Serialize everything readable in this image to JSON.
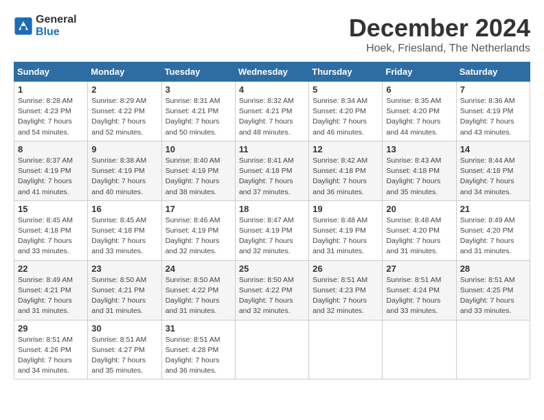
{
  "logo": {
    "line1": "General",
    "line2": "Blue"
  },
  "title": "December 2024",
  "subtitle": "Hoek, Friesland, The Netherlands",
  "days_header": [
    "Sunday",
    "Monday",
    "Tuesday",
    "Wednesday",
    "Thursday",
    "Friday",
    "Saturday"
  ],
  "weeks": [
    [
      {
        "day": "1",
        "sunrise": "8:28 AM",
        "sunset": "4:23 PM",
        "daylight": "7 hours and 54 minutes."
      },
      {
        "day": "2",
        "sunrise": "8:29 AM",
        "sunset": "4:22 PM",
        "daylight": "7 hours and 52 minutes."
      },
      {
        "day": "3",
        "sunrise": "8:31 AM",
        "sunset": "4:21 PM",
        "daylight": "7 hours and 50 minutes."
      },
      {
        "day": "4",
        "sunrise": "8:32 AM",
        "sunset": "4:21 PM",
        "daylight": "7 hours and 48 minutes."
      },
      {
        "day": "5",
        "sunrise": "8:34 AM",
        "sunset": "4:20 PM",
        "daylight": "7 hours and 46 minutes."
      },
      {
        "day": "6",
        "sunrise": "8:35 AM",
        "sunset": "4:20 PM",
        "daylight": "7 hours and 44 minutes."
      },
      {
        "day": "7",
        "sunrise": "8:36 AM",
        "sunset": "4:19 PM",
        "daylight": "7 hours and 43 minutes."
      }
    ],
    [
      {
        "day": "8",
        "sunrise": "8:37 AM",
        "sunset": "4:19 PM",
        "daylight": "7 hours and 41 minutes."
      },
      {
        "day": "9",
        "sunrise": "8:38 AM",
        "sunset": "4:19 PM",
        "daylight": "7 hours and 40 minutes."
      },
      {
        "day": "10",
        "sunrise": "8:40 AM",
        "sunset": "4:19 PM",
        "daylight": "7 hours and 38 minutes."
      },
      {
        "day": "11",
        "sunrise": "8:41 AM",
        "sunset": "4:18 PM",
        "daylight": "7 hours and 37 minutes."
      },
      {
        "day": "12",
        "sunrise": "8:42 AM",
        "sunset": "4:18 PM",
        "daylight": "7 hours and 36 minutes."
      },
      {
        "day": "13",
        "sunrise": "8:43 AM",
        "sunset": "4:18 PM",
        "daylight": "7 hours and 35 minutes."
      },
      {
        "day": "14",
        "sunrise": "8:44 AM",
        "sunset": "4:18 PM",
        "daylight": "7 hours and 34 minutes."
      }
    ],
    [
      {
        "day": "15",
        "sunrise": "8:45 AM",
        "sunset": "4:18 PM",
        "daylight": "7 hours and 33 minutes."
      },
      {
        "day": "16",
        "sunrise": "8:45 AM",
        "sunset": "4:18 PM",
        "daylight": "7 hours and 33 minutes."
      },
      {
        "day": "17",
        "sunrise": "8:46 AM",
        "sunset": "4:19 PM",
        "daylight": "7 hours and 32 minutes."
      },
      {
        "day": "18",
        "sunrise": "8:47 AM",
        "sunset": "4:19 PM",
        "daylight": "7 hours and 32 minutes."
      },
      {
        "day": "19",
        "sunrise": "8:48 AM",
        "sunset": "4:19 PM",
        "daylight": "7 hours and 31 minutes."
      },
      {
        "day": "20",
        "sunrise": "8:48 AM",
        "sunset": "4:20 PM",
        "daylight": "7 hours and 31 minutes."
      },
      {
        "day": "21",
        "sunrise": "8:49 AM",
        "sunset": "4:20 PM",
        "daylight": "7 hours and 31 minutes."
      }
    ],
    [
      {
        "day": "22",
        "sunrise": "8:49 AM",
        "sunset": "4:21 PM",
        "daylight": "7 hours and 31 minutes."
      },
      {
        "day": "23",
        "sunrise": "8:50 AM",
        "sunset": "4:21 PM",
        "daylight": "7 hours and 31 minutes."
      },
      {
        "day": "24",
        "sunrise": "8:50 AM",
        "sunset": "4:22 PM",
        "daylight": "7 hours and 31 minutes."
      },
      {
        "day": "25",
        "sunrise": "8:50 AM",
        "sunset": "4:22 PM",
        "daylight": "7 hours and 32 minutes."
      },
      {
        "day": "26",
        "sunrise": "8:51 AM",
        "sunset": "4:23 PM",
        "daylight": "7 hours and 32 minutes."
      },
      {
        "day": "27",
        "sunrise": "8:51 AM",
        "sunset": "4:24 PM",
        "daylight": "7 hours and 33 minutes."
      },
      {
        "day": "28",
        "sunrise": "8:51 AM",
        "sunset": "4:25 PM",
        "daylight": "7 hours and 33 minutes."
      }
    ],
    [
      {
        "day": "29",
        "sunrise": "8:51 AM",
        "sunset": "4:26 PM",
        "daylight": "7 hours and 34 minutes."
      },
      {
        "day": "30",
        "sunrise": "8:51 AM",
        "sunset": "4:27 PM",
        "daylight": "7 hours and 35 minutes."
      },
      {
        "day": "31",
        "sunrise": "8:51 AM",
        "sunset": "4:28 PM",
        "daylight": "7 hours and 36 minutes."
      },
      null,
      null,
      null,
      null
    ]
  ]
}
